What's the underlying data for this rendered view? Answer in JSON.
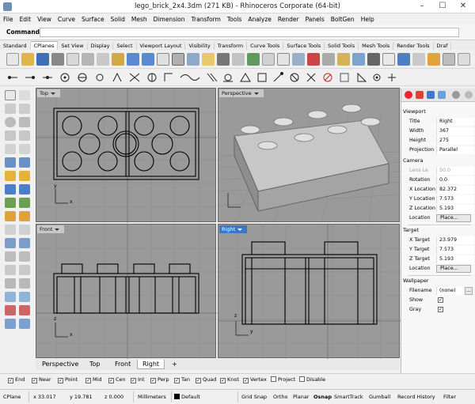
{
  "window": {
    "title": "lego_brick_2x4.3dm (271 KB) - Rhinoceros Corporate (64-bit)",
    "minimize": "–",
    "maximize": "☐",
    "close": "✕"
  },
  "menu": [
    "File",
    "Edit",
    "View",
    "Curve",
    "Surface",
    "Solid",
    "Mesh",
    "Dimension",
    "Transform",
    "Tools",
    "Analyze",
    "Render",
    "Panels",
    "BoltGen",
    "Help"
  ],
  "command": {
    "label": "Command:",
    "value": ""
  },
  "toolbar_tabs": [
    "Standard",
    "CPlanes",
    "Set View",
    "Display",
    "Select",
    "Viewport Layout",
    "Visibility",
    "Transform",
    "Curve Tools",
    "Surface Tools",
    "Solid Tools",
    "Mesh Tools",
    "Render Tools",
    "Draf"
  ],
  "toolbar_tabs_active": "CPlanes",
  "viewports": {
    "top": {
      "label": "Top"
    },
    "perspective": {
      "label": "Perspective"
    },
    "front": {
      "label": "Front"
    },
    "right": {
      "label": "Right"
    },
    "axis_x": "x",
    "axis_y": "y",
    "axis_z": "z"
  },
  "viewport_tabs": [
    "Perspective",
    "Top",
    "Front",
    "Right"
  ],
  "viewport_tabs_active": "Right",
  "viewport_tab_add": "+",
  "osnap": [
    {
      "label": "End",
      "checked": true
    },
    {
      "label": "Near",
      "checked": true
    },
    {
      "label": "Point",
      "checked": true
    },
    {
      "label": "Mid",
      "checked": true
    },
    {
      "label": "Cen",
      "checked": true
    },
    {
      "label": "Int",
      "checked": true
    },
    {
      "label": "Perp",
      "checked": true
    },
    {
      "label": "Tan",
      "checked": true
    },
    {
      "label": "Quad",
      "checked": true
    },
    {
      "label": "Knot",
      "checked": true
    },
    {
      "label": "Vertex",
      "checked": true
    },
    {
      "label": "Project",
      "checked": false
    },
    {
      "label": "Disable",
      "checked": false
    }
  ],
  "status": {
    "cplane": "CPlane",
    "x": "x 33.017",
    "y": "y 19.781",
    "z": "z 0.000",
    "units": "Millimeters",
    "layer": "Default",
    "grid_snap": "Grid Snap",
    "ortho": "Ortho",
    "planar": "Planar",
    "osnap": "Osnap",
    "smarttrack": "SmartTrack",
    "gumball": "Gumball",
    "record_history": "Record History",
    "filter": "Filter"
  },
  "panel": {
    "viewport_section": "Viewport",
    "title_label": "Title",
    "title_value": "Right",
    "width_label": "Width",
    "width_value": "367",
    "height_label": "Height",
    "height_value": "275",
    "projection_label": "Projection",
    "projection_value": "Parallel",
    "camera_section": "Camera",
    "lens_label": "Lens Le",
    "lens_value": "50.0",
    "rotation_label": "Rotation",
    "rotation_value": "0.0",
    "xloc_label": "X Location",
    "xloc_value": "82.372",
    "yloc_label": "Y Location",
    "yloc_value": "7.573",
    "zloc_label": "Z Location",
    "zloc_value": "5.193",
    "location_label": "Location",
    "location_button": "Place...",
    "target_section": "Target",
    "xt_label": "X Target",
    "xt_value": "23.979",
    "yt_label": "Y Target",
    "yt_value": "7.573",
    "zt_label": "Z Target",
    "zt_value": "5.193",
    "tloc_label": "Location",
    "tloc_button": "Place...",
    "wallpaper_section": "Wallpaper",
    "filename_label": "Filename",
    "filename_value": "(none)",
    "filename_button": "...",
    "show_label": "Show",
    "show_checked": "✓",
    "gray_label": "Gray",
    "gray_checked": "✓"
  },
  "colors": {
    "viewport_bg": "#9a9a9a",
    "active_title": "#3b77c6",
    "grid": "#8c8c8c"
  }
}
